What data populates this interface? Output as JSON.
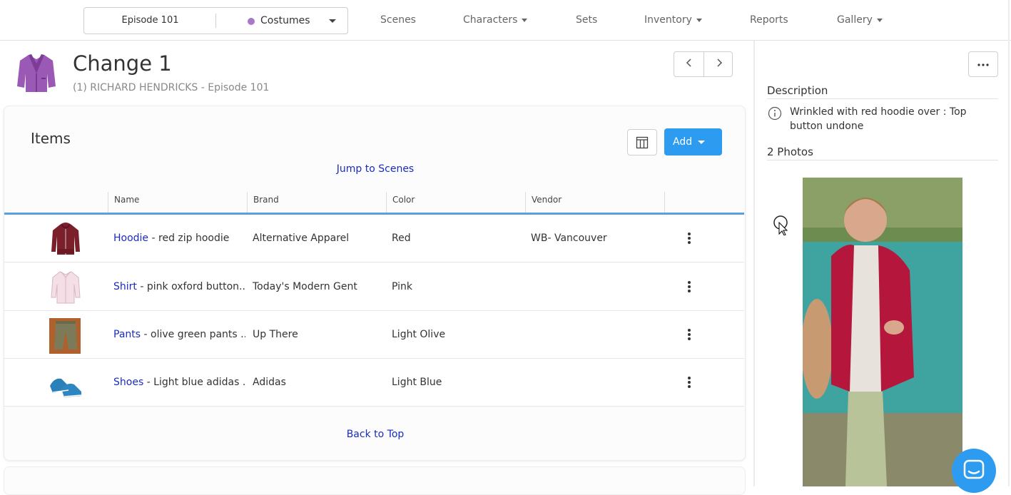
{
  "topbar": {
    "episode": "Episode 101",
    "department": "Costumes",
    "department_color": "#a77ac9",
    "nav": [
      {
        "label": "Scenes",
        "has_caret": false
      },
      {
        "label": "Characters",
        "has_caret": true
      },
      {
        "label": "Sets",
        "has_caret": false
      },
      {
        "label": "Inventory",
        "has_caret": true
      },
      {
        "label": "Reports",
        "has_caret": false
      },
      {
        "label": "Gallery",
        "has_caret": true
      }
    ]
  },
  "header": {
    "title": "Change 1",
    "subtitle": "(1) RICHARD HENDRICKS - Episode 101",
    "icon": "jacket-icon",
    "prev_icon": "chevron-left-icon",
    "next_icon": "chevron-right-icon"
  },
  "items": {
    "title": "Items",
    "add_label": "Add",
    "columns_icon": "columns-icon",
    "jump_link": "Jump to Scenes",
    "back_link": "Back to Top",
    "columns": [
      "Name",
      "Brand",
      "Color",
      "Vendor"
    ],
    "rows": [
      {
        "name": "Hoodie",
        "desc": " - red zip hoodie",
        "brand": "Alternative Apparel",
        "color": "Red",
        "vendor": "WB- Vancouver",
        "thumb": "hoodie-thumbnail"
      },
      {
        "name": "Shirt",
        "desc": " - pink oxford button...",
        "brand": "Today's Modern Gent",
        "color": "Pink",
        "vendor": "",
        "thumb": "shirt-thumbnail"
      },
      {
        "name": "Pants",
        "desc": " - olive green pants ...",
        "brand": "Up There",
        "color": "Light Olive",
        "vendor": "",
        "thumb": "pants-thumbnail"
      },
      {
        "name": "Shoes",
        "desc": " - Light blue adidas ...",
        "brand": "Adidas",
        "color": "Light Blue",
        "vendor": "",
        "thumb": "shoes-thumbnail"
      }
    ],
    "accent_color": "#2d9cf0",
    "link_color": "#1a2bbf"
  },
  "panel": {
    "more_icon": "ellipsis-icon",
    "description_heading": "Description",
    "description_text": "Wrinkled with red hoodie over : Top button undone",
    "photos_heading": "2 Photos",
    "info_icon": "info-icon",
    "chat_icon": "chat-icon"
  }
}
